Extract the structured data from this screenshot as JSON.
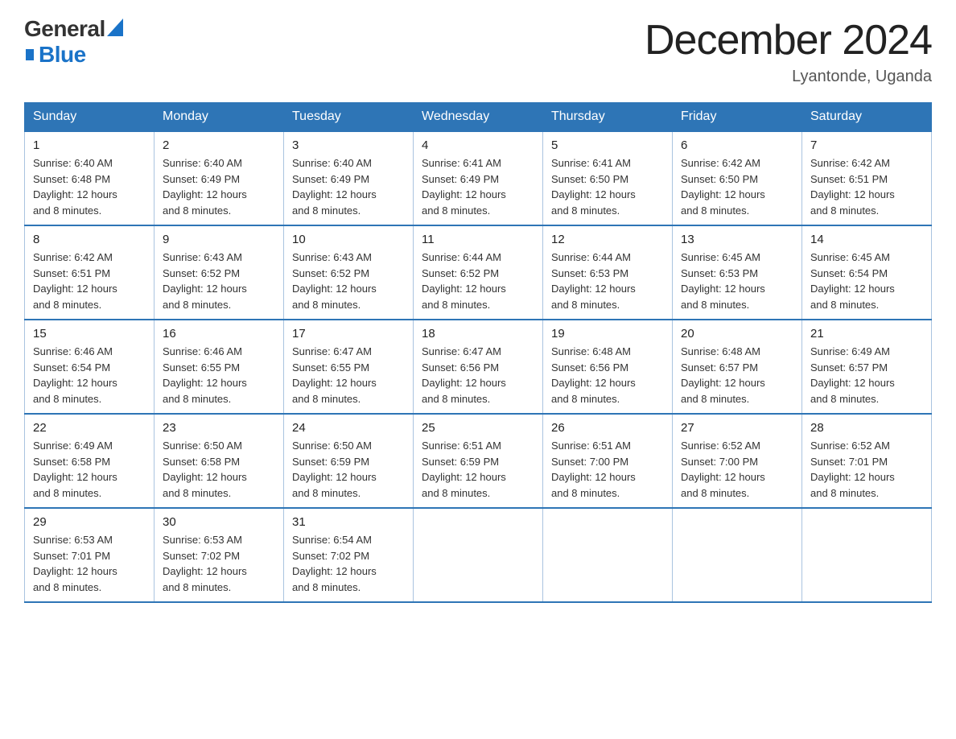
{
  "logo": {
    "general": "General",
    "blue": "Blue",
    "alt": "GeneralBlue logo"
  },
  "title": "December 2024",
  "subtitle": "Lyantonde, Uganda",
  "weekdays": [
    "Sunday",
    "Monday",
    "Tuesday",
    "Wednesday",
    "Thursday",
    "Friday",
    "Saturday"
  ],
  "weeks": [
    [
      {
        "day": "1",
        "sunrise": "6:40 AM",
        "sunset": "6:48 PM",
        "daylight": "12 hours and 8 minutes."
      },
      {
        "day": "2",
        "sunrise": "6:40 AM",
        "sunset": "6:49 PM",
        "daylight": "12 hours and 8 minutes."
      },
      {
        "day": "3",
        "sunrise": "6:40 AM",
        "sunset": "6:49 PM",
        "daylight": "12 hours and 8 minutes."
      },
      {
        "day": "4",
        "sunrise": "6:41 AM",
        "sunset": "6:49 PM",
        "daylight": "12 hours and 8 minutes."
      },
      {
        "day": "5",
        "sunrise": "6:41 AM",
        "sunset": "6:50 PM",
        "daylight": "12 hours and 8 minutes."
      },
      {
        "day": "6",
        "sunrise": "6:42 AM",
        "sunset": "6:50 PM",
        "daylight": "12 hours and 8 minutes."
      },
      {
        "day": "7",
        "sunrise": "6:42 AM",
        "sunset": "6:51 PM",
        "daylight": "12 hours and 8 minutes."
      }
    ],
    [
      {
        "day": "8",
        "sunrise": "6:42 AM",
        "sunset": "6:51 PM",
        "daylight": "12 hours and 8 minutes."
      },
      {
        "day": "9",
        "sunrise": "6:43 AM",
        "sunset": "6:52 PM",
        "daylight": "12 hours and 8 minutes."
      },
      {
        "day": "10",
        "sunrise": "6:43 AM",
        "sunset": "6:52 PM",
        "daylight": "12 hours and 8 minutes."
      },
      {
        "day": "11",
        "sunrise": "6:44 AM",
        "sunset": "6:52 PM",
        "daylight": "12 hours and 8 minutes."
      },
      {
        "day": "12",
        "sunrise": "6:44 AM",
        "sunset": "6:53 PM",
        "daylight": "12 hours and 8 minutes."
      },
      {
        "day": "13",
        "sunrise": "6:45 AM",
        "sunset": "6:53 PM",
        "daylight": "12 hours and 8 minutes."
      },
      {
        "day": "14",
        "sunrise": "6:45 AM",
        "sunset": "6:54 PM",
        "daylight": "12 hours and 8 minutes."
      }
    ],
    [
      {
        "day": "15",
        "sunrise": "6:46 AM",
        "sunset": "6:54 PM",
        "daylight": "12 hours and 8 minutes."
      },
      {
        "day": "16",
        "sunrise": "6:46 AM",
        "sunset": "6:55 PM",
        "daylight": "12 hours and 8 minutes."
      },
      {
        "day": "17",
        "sunrise": "6:47 AM",
        "sunset": "6:55 PM",
        "daylight": "12 hours and 8 minutes."
      },
      {
        "day": "18",
        "sunrise": "6:47 AM",
        "sunset": "6:56 PM",
        "daylight": "12 hours and 8 minutes."
      },
      {
        "day": "19",
        "sunrise": "6:48 AM",
        "sunset": "6:56 PM",
        "daylight": "12 hours and 8 minutes."
      },
      {
        "day": "20",
        "sunrise": "6:48 AM",
        "sunset": "6:57 PM",
        "daylight": "12 hours and 8 minutes."
      },
      {
        "day": "21",
        "sunrise": "6:49 AM",
        "sunset": "6:57 PM",
        "daylight": "12 hours and 8 minutes."
      }
    ],
    [
      {
        "day": "22",
        "sunrise": "6:49 AM",
        "sunset": "6:58 PM",
        "daylight": "12 hours and 8 minutes."
      },
      {
        "day": "23",
        "sunrise": "6:50 AM",
        "sunset": "6:58 PM",
        "daylight": "12 hours and 8 minutes."
      },
      {
        "day": "24",
        "sunrise": "6:50 AM",
        "sunset": "6:59 PM",
        "daylight": "12 hours and 8 minutes."
      },
      {
        "day": "25",
        "sunrise": "6:51 AM",
        "sunset": "6:59 PM",
        "daylight": "12 hours and 8 minutes."
      },
      {
        "day": "26",
        "sunrise": "6:51 AM",
        "sunset": "7:00 PM",
        "daylight": "12 hours and 8 minutes."
      },
      {
        "day": "27",
        "sunrise": "6:52 AM",
        "sunset": "7:00 PM",
        "daylight": "12 hours and 8 minutes."
      },
      {
        "day": "28",
        "sunrise": "6:52 AM",
        "sunset": "7:01 PM",
        "daylight": "12 hours and 8 minutes."
      }
    ],
    [
      {
        "day": "29",
        "sunrise": "6:53 AM",
        "sunset": "7:01 PM",
        "daylight": "12 hours and 8 minutes."
      },
      {
        "day": "30",
        "sunrise": "6:53 AM",
        "sunset": "7:02 PM",
        "daylight": "12 hours and 8 minutes."
      },
      {
        "day": "31",
        "sunrise": "6:54 AM",
        "sunset": "7:02 PM",
        "daylight": "12 hours and 8 minutes."
      },
      null,
      null,
      null,
      null
    ]
  ],
  "labels": {
    "sunrise": "Sunrise:",
    "sunset": "Sunset:",
    "daylight": "Daylight:"
  }
}
